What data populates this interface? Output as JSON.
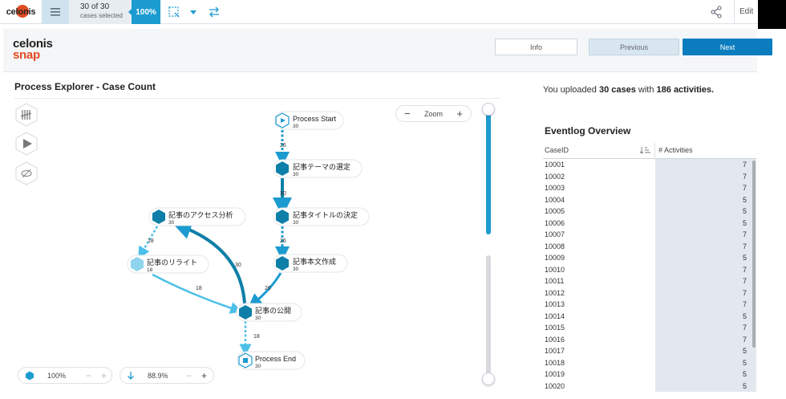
{
  "topbar": {
    "logo_text": "celonis",
    "cases_count": "30 of 30",
    "cases_label": "cases selected",
    "selection_pct": "100%",
    "edit_label": "Edit"
  },
  "header": {
    "logo_word1": "celonis",
    "logo_word2": "snap",
    "info_label": "Info",
    "previous_label": "Previous",
    "next_label": "Next"
  },
  "explorer": {
    "title": "Process Explorer - Case Count",
    "zoom_label": "Zoom",
    "zoom_minus": "−",
    "zoom_plus": "+",
    "activities_pct": "100%",
    "connections_pct": "88.9%",
    "minus": "−",
    "plus": "+",
    "nodes": {
      "start": {
        "label": "Process Start",
        "count": "30"
      },
      "theme": {
        "label": "記事テーマの選定",
        "count": "30"
      },
      "title_decide": {
        "label": "記事タイトルの決定",
        "count": "30"
      },
      "body": {
        "label": "記事本文作成",
        "count": "30"
      },
      "access": {
        "label": "記事のアクセス分析",
        "count": "30"
      },
      "rewrite": {
        "label": "記事のリライト",
        "count": "18"
      },
      "publish": {
        "label": "記事の公開",
        "count": "30"
      },
      "end": {
        "label": "Process End",
        "count": "30"
      }
    },
    "edges": {
      "start_theme": "26",
      "theme_title": "30",
      "title_body": "26",
      "body_publish": "26",
      "publish_access": "30",
      "access_rewrite": "18",
      "rewrite_publish": "18",
      "publish_end": "18"
    },
    "colors": {
      "accent": "#1c9bd0",
      "node_dark": "#0e7fa8",
      "node_light": "#8fd3ec"
    }
  },
  "overview": {
    "msg_prefix": "You uploaded ",
    "msg_cases": "30 cases",
    "msg_mid": " with ",
    "msg_acts": "186 activities.",
    "title": "Eventlog Overview",
    "col_caseid": "CaseID",
    "col_activities": "# Activities",
    "rows": [
      {
        "id": "10001",
        "n": "7"
      },
      {
        "id": "10002",
        "n": "7"
      },
      {
        "id": "10003",
        "n": "7"
      },
      {
        "id": "10004",
        "n": "5"
      },
      {
        "id": "10005",
        "n": "5"
      },
      {
        "id": "10006",
        "n": "5"
      },
      {
        "id": "10007",
        "n": "7"
      },
      {
        "id": "10008",
        "n": "7"
      },
      {
        "id": "10009",
        "n": "5"
      },
      {
        "id": "10010",
        "n": "7"
      },
      {
        "id": "10011",
        "n": "7"
      },
      {
        "id": "10012",
        "n": "7"
      },
      {
        "id": "10013",
        "n": "7"
      },
      {
        "id": "10014",
        "n": "5"
      },
      {
        "id": "10015",
        "n": "7"
      },
      {
        "id": "10016",
        "n": "7"
      },
      {
        "id": "10017",
        "n": "5"
      },
      {
        "id": "10018",
        "n": "5"
      },
      {
        "id": "10019",
        "n": "5"
      },
      {
        "id": "10020",
        "n": "5"
      }
    ]
  }
}
